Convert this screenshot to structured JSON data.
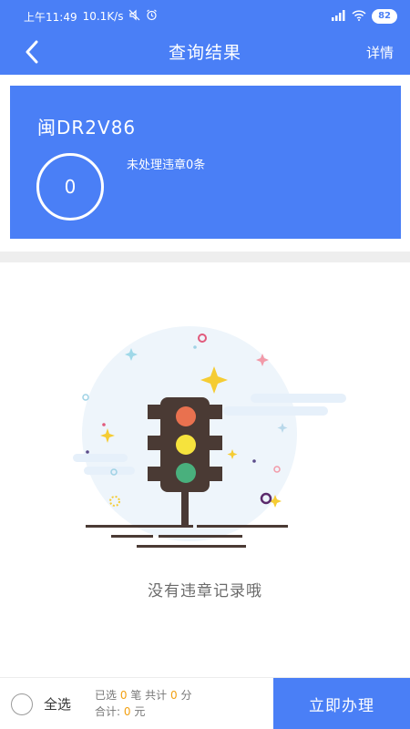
{
  "status_bar": {
    "time": "上午11:49",
    "speed": "10.1K/s",
    "battery": "82"
  },
  "nav": {
    "title": "查询结果",
    "detail_label": "详情"
  },
  "car": {
    "plate": "闽DR2V86",
    "violation_count": "0",
    "pending_text": "未处理违章0条"
  },
  "empty": {
    "message": "没有违章记录哦"
  },
  "bottom": {
    "select_all_label": "全选",
    "selected_prefix": "已选",
    "selected_count": "0",
    "selected_unit": "笔",
    "total_points_prefix": "共计",
    "total_points": "0",
    "points_unit": "分",
    "total_money_prefix": "合计:",
    "total_money": "0",
    "money_unit": "元",
    "submit_label": "立即办理"
  },
  "colors": {
    "primary": "#4a7ff6",
    "highlight": "#f2a012",
    "light_red": "#e9714f",
    "light_yellow": "#f6e33d",
    "light_green": "#49b07d"
  }
}
